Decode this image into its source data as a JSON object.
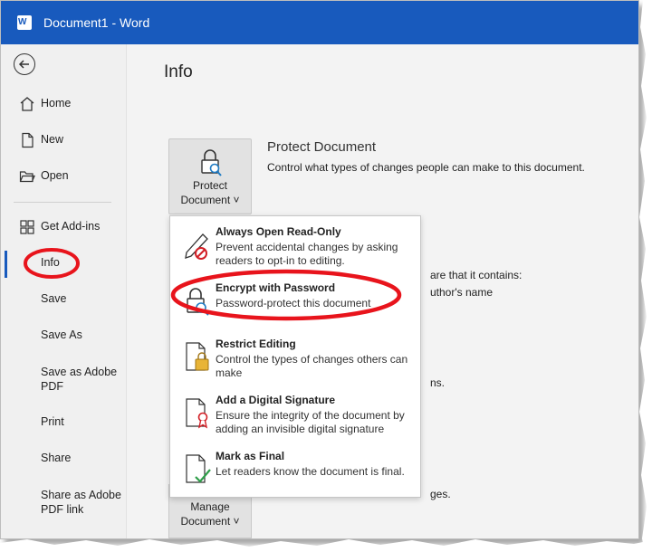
{
  "window": {
    "app_icon": "word-logo",
    "title": "Document1  -  Word"
  },
  "sidebar": {
    "back_icon": "back-arrow-icon",
    "items": [
      {
        "label": "Home",
        "icon": "home-icon"
      },
      {
        "label": "New",
        "icon": "new-document-icon"
      },
      {
        "label": "Open",
        "icon": "folder-open-icon"
      },
      {
        "label": "Get Add-ins",
        "icon": "add-ins-grid-icon"
      },
      {
        "label": "Info",
        "active": true
      },
      {
        "label": "Save"
      },
      {
        "label": "Save As"
      },
      {
        "label": "Save as Adobe PDF"
      },
      {
        "label": "Print"
      },
      {
        "label": "Share"
      },
      {
        "label": "Share as Adobe PDF link"
      }
    ]
  },
  "main": {
    "title": "Info",
    "protect_tile": {
      "line1": "Protect",
      "line2": "Document ˅",
      "icon": "lock-search-icon"
    },
    "protect_heading": "Protect Document",
    "protect_desc": "Control what types of changes people can make to this document.",
    "bg_fragments": {
      "inspect": "are that it contains:",
      "author": "uthor's name",
      "versions": "ns.",
      "changes": "ges."
    },
    "manage_tile": {
      "line1": "Manage",
      "line2": "Document ˅"
    }
  },
  "dropdown": {
    "items": [
      {
        "title": "Always Open Read-Only",
        "desc": "Prevent accidental changes by asking readers to opt-in to editing.",
        "icon": "pencil-no-icon"
      },
      {
        "title": "Encrypt with Password",
        "desc": "Password-protect this document",
        "icon": "lock-search-icon"
      },
      {
        "title": "Restrict Editing",
        "desc": "Control the types of changes others can make",
        "icon": "document-lock-icon"
      },
      {
        "title": "Add a Digital Signature",
        "desc": "Ensure the integrity of the document by adding an invisible digital signature",
        "icon": "document-ribbon-icon"
      },
      {
        "title": "Mark as Final",
        "desc": "Let readers know the document is final.",
        "icon": "document-check-icon"
      }
    ]
  },
  "colors": {
    "titlebar": "#185abd",
    "highlight_oval": "#e8141c",
    "sidebar_bg": "#f0f0f0",
    "content_bg": "#f3f3f3"
  }
}
